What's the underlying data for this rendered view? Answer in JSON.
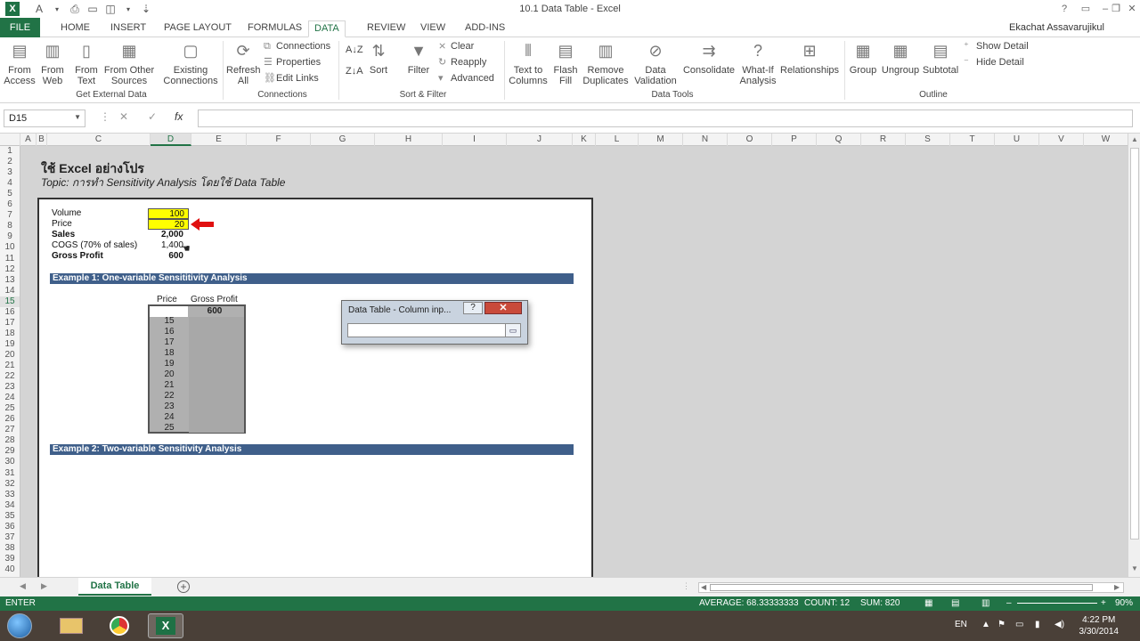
{
  "window": {
    "title": "10.1 Data Table - Excel",
    "user": "Ekachat Assavarujikul"
  },
  "qat": {
    "font_label": "A"
  },
  "tabs": [
    "FILE",
    "HOME",
    "INSERT",
    "PAGE LAYOUT",
    "FORMULAS",
    "DATA",
    "REVIEW",
    "VIEW",
    "ADD-INS"
  ],
  "active_tab": "DATA",
  "ribbon": {
    "get_external": {
      "from_access": [
        "From",
        "Access"
      ],
      "from_web": [
        "From",
        "Web"
      ],
      "from_text": [
        "From",
        "Text"
      ],
      "from_other": [
        "From Other",
        "Sources"
      ],
      "existing": [
        "Existing",
        "Connections"
      ],
      "label": "Get External Data"
    },
    "connections": {
      "refresh": [
        "Refresh",
        "All"
      ],
      "connections": "Connections",
      "properties": "Properties",
      "edit_links": "Edit Links",
      "label": "Connections"
    },
    "sort_filter": {
      "sort": "Sort",
      "filter": "Filter",
      "clear": "Clear",
      "reapply": "Reapply",
      "advanced": "Advanced",
      "label": "Sort & Filter"
    },
    "data_tools": {
      "text_to_columns": [
        "Text to",
        "Columns"
      ],
      "flash_fill": [
        "Flash",
        "Fill"
      ],
      "remove_dup": [
        "Remove",
        "Duplicates"
      ],
      "validation": [
        "Data",
        "Validation"
      ],
      "consolidate": "Consolidate",
      "whatif": [
        "What-If",
        "Analysis"
      ],
      "relationships": "Relationships",
      "label": "Data Tools"
    },
    "outline": {
      "group": "Group",
      "ungroup": "Ungroup",
      "subtotal": "Subtotal",
      "show_detail": "Show Detail",
      "hide_detail": "Hide Detail",
      "label": "Outline"
    }
  },
  "formula_bar": {
    "name_box": "D15",
    "fx": "fx",
    "value": ""
  },
  "columns": [
    "A",
    "B",
    "C",
    "D",
    "E",
    "F",
    "G",
    "H",
    "I",
    "J",
    "K",
    "L",
    "M",
    "N",
    "O",
    "P",
    "Q",
    "R",
    "S",
    "T",
    "U",
    "V",
    "W"
  ],
  "selected_column": "D",
  "rows": [
    "1",
    "2",
    "3",
    "4",
    "5",
    "6",
    "7",
    "8",
    "9",
    "10",
    "11",
    "12",
    "13",
    "14",
    "15",
    "16",
    "17",
    "18",
    "19",
    "20",
    "21",
    "22",
    "23",
    "24",
    "25",
    "26",
    "27",
    "28",
    "29",
    "30",
    "31",
    "32",
    "33",
    "34",
    "35",
    "36",
    "37",
    "38",
    "39",
    "40"
  ],
  "selected_row": "15",
  "sheet": {
    "title": "ใช้ Excel อย่างโปร",
    "subtitle": "Topic: การทำ Sensitivity Analysis โดยใช้ Data Table",
    "inputs": [
      {
        "label": "Volume",
        "value": "100",
        "bold": false,
        "highlight": true
      },
      {
        "label": "Price",
        "value": "20",
        "bold": false,
        "highlight": true
      },
      {
        "label": "Sales",
        "value": "2,000",
        "bold": true,
        "highlight": false
      },
      {
        "label": "COGS (70% of sales)",
        "value": "1,400",
        "bold": false,
        "highlight": false
      },
      {
        "label": "Gross Profit",
        "value": "600",
        "bold": true,
        "highlight": false
      }
    ],
    "example1": "Example 1: One-variable Sensititivity Analysis",
    "example2": "Example 2: Two-variable Sensitivity Analysis",
    "table": {
      "col1_header": "Price",
      "col2_header": "Gross Profit",
      "formula_value": "600",
      "prices": [
        "15",
        "16",
        "17",
        "18",
        "19",
        "20",
        "21",
        "22",
        "23",
        "24",
        "25"
      ]
    }
  },
  "dialog": {
    "title": "Data Table - Column inp...",
    "help": "?",
    "close": "✕",
    "input_value": ""
  },
  "sheet_tab": "Data Table",
  "status": {
    "mode": "ENTER",
    "average": "AVERAGE: 68.33333333",
    "count": "COUNT: 12",
    "sum": "SUM: 820",
    "zoom": "90%"
  },
  "taskbar": {
    "lang": "EN",
    "time": "4:22 PM",
    "date": "3/30/2014"
  }
}
